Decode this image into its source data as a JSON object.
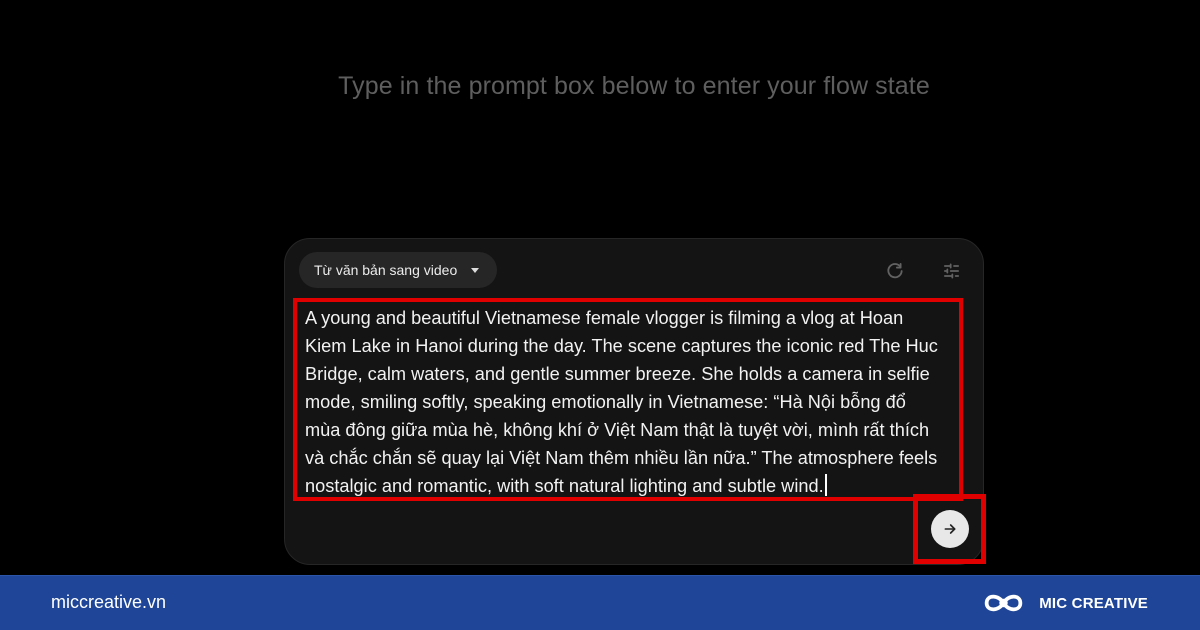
{
  "hero": {
    "text": "Type in the prompt box below to enter your flow state"
  },
  "prompt_panel": {
    "mode_selector": {
      "selected": "Từ văn bản sang video",
      "icon": "chevron-down-icon"
    },
    "actions": {
      "refresh_icon": "refresh-icon",
      "settings_icon": "tune-icon"
    },
    "prompt_lines": [
      "A young and beautiful Vietnamese female vlogger is filming a vlog at Hoan",
      "Kiem Lake in Hanoi during the day. The scene captures the iconic red The Huc",
      "Bridge, calm waters, and gentle summer breeze. She holds a camera in selfie",
      "mode, smiling softly, speaking emotionally in Vietnamese: “Hà Nội bỗng đổ",
      "mùa đông giữa mùa hè, không khí ở Việt Nam thật là tuyệt vời, mình rất thích",
      "và chắc chắn sẽ quay lại Việt Nam thêm nhiều lần nữa.” The atmosphere feels",
      "nostalgic and romantic, with soft natural lighting and subtle wind."
    ],
    "send_button_icon": "arrow-right-icon",
    "highlight_color": "#e00000"
  },
  "footer": {
    "site": "miccreative.vn",
    "brand_name": "MIC CREATIVE",
    "background": "#1e4597"
  }
}
